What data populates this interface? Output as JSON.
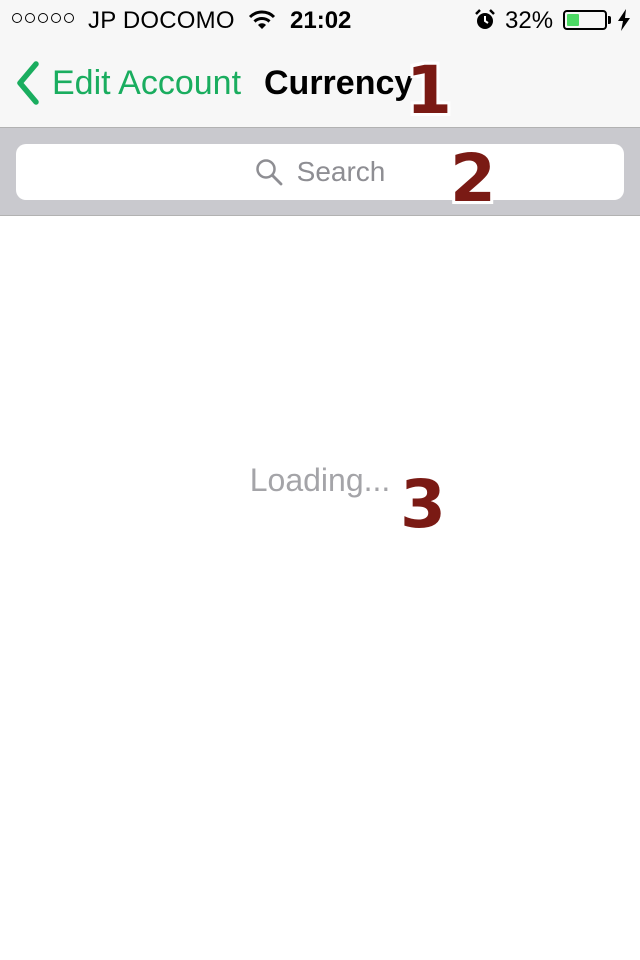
{
  "status_bar": {
    "carrier": "JP DOCOMO",
    "time": "21:02",
    "battery_percent": "32%",
    "battery_level": 0.32,
    "signal_icon": "signal-dots-icon",
    "wifi_icon": "wifi-icon",
    "alarm_icon": "alarm-clock-icon",
    "charging_icon": "lightning-bolt-icon"
  },
  "nav": {
    "back_label": "Edit Account",
    "title": "Currency"
  },
  "search": {
    "placeholder": "Search"
  },
  "content": {
    "loading_text": "Loading..."
  },
  "annotations": [
    "1",
    "2",
    "3"
  ],
  "colors": {
    "accent": "#1aad5f",
    "battery_fill": "#4cd964",
    "marker": "#7a1a14",
    "search_bar_bg": "#c9c9ce"
  }
}
